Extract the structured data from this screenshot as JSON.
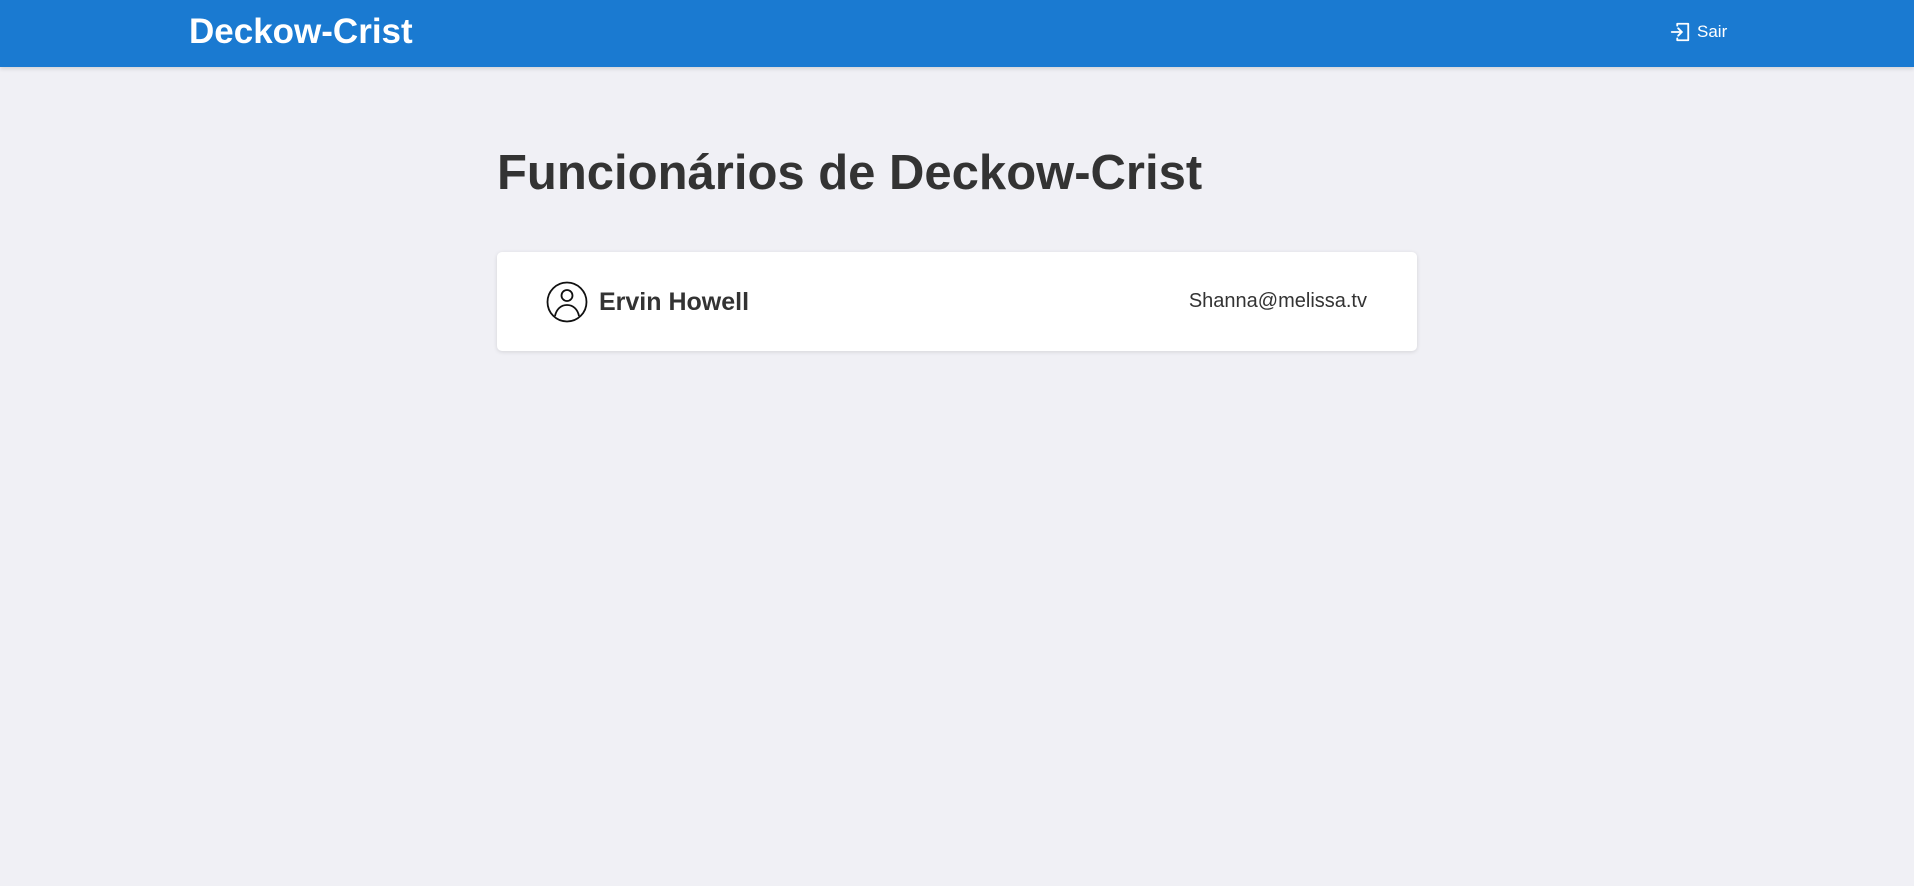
{
  "header": {
    "brand": "Deckow-Crist",
    "logout_label": "Sair",
    "logout_icon": "logout-icon"
  },
  "main": {
    "title": "Funcionários de Deckow-Crist",
    "employees": [
      {
        "name": "Ervin Howell",
        "email": "Shanna@melissa.tv",
        "icon": "user-circle-icon"
      }
    ]
  },
  "colors": {
    "header_bg": "#1a7ad1",
    "page_bg": "#f0f0f5",
    "text": "#333333",
    "card_bg": "#ffffff"
  }
}
